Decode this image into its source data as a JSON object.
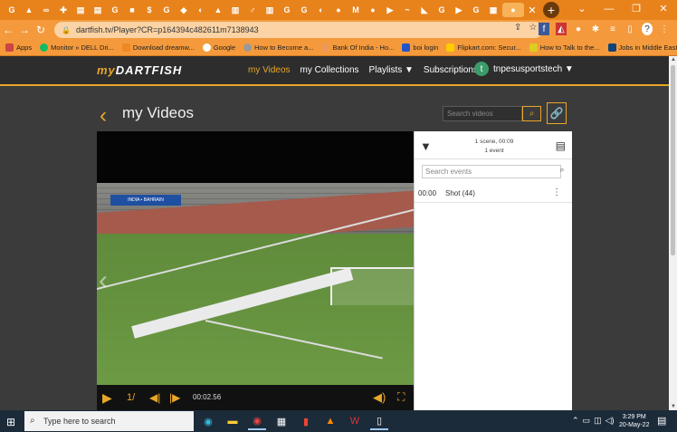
{
  "browser": {
    "tab_count": 29,
    "url": "dartfish.tv/Player?CR=p164394c482611m7138943",
    "bookmarks": [
      "Apps",
      "Monitor » DELL Dri...",
      "Download dreamw...",
      "Google",
      "How to Become a...",
      "Bank Of India - Ho...",
      "boi login",
      "Flipkart.com: Secur...",
      "How to Talk to the...",
      "Jobs in Middle East..."
    ]
  },
  "site": {
    "logo_my": "my",
    "logo_rest": "DARTFISH",
    "nav": [
      "my Videos",
      "my Collections",
      "Playlists ▼",
      "Subscriptions ▼"
    ],
    "user_initial": "t",
    "username": "tnpesusportstech ▼"
  },
  "page": {
    "title": "my Videos",
    "search_placeholder": "Search videos"
  },
  "player": {
    "time": "00:02.56",
    "speed": "1/",
    "scorebug": "INDIA • BAHRAIN"
  },
  "events_panel": {
    "summary_line1": "1 scene, 00:09",
    "summary_line2": "1 event",
    "search_placeholder": "Search events",
    "events": [
      {
        "time": "00:00",
        "name": "Shot (44)"
      }
    ]
  },
  "taskbar": {
    "search_text": "Type here to search",
    "time": "3:29 PM",
    "date": "20-May-22"
  },
  "colors": {
    "accent": "#e8a629",
    "browser": "#e8831c"
  }
}
